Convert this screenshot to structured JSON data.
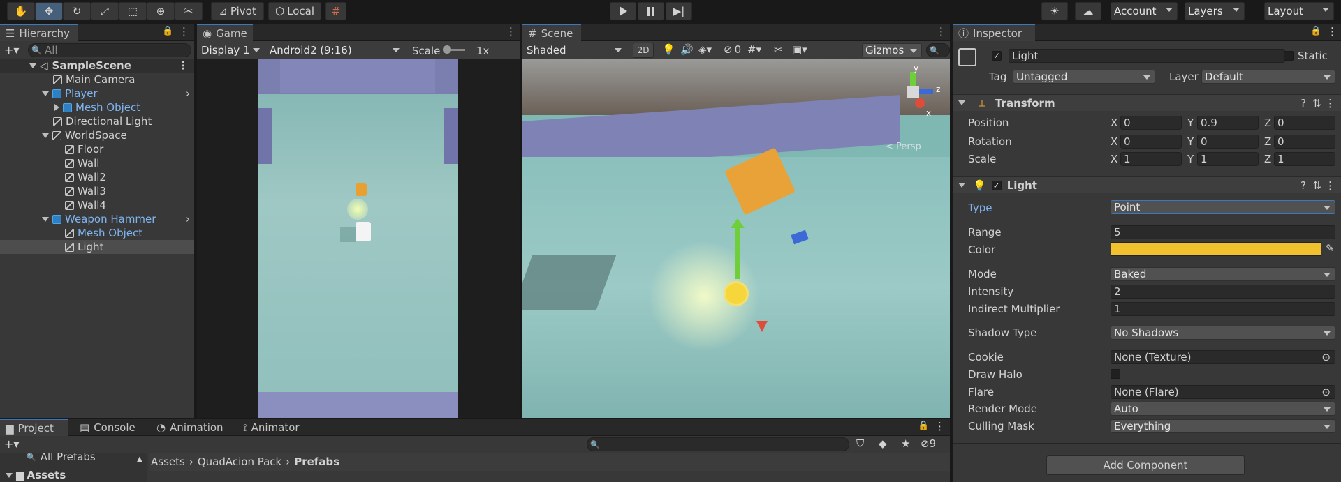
{
  "toolbar": {
    "pivot_label": "Pivot",
    "local_label": "Local",
    "account_label": "Account",
    "layers_label": "Layers",
    "layout_label": "Layout"
  },
  "hierarchy": {
    "tab_label": "Hierarchy",
    "search_placeholder": "All",
    "scene_name": "SampleScene",
    "items": [
      {
        "label": "Main Camera"
      },
      {
        "label": "Player"
      },
      {
        "label": "Mesh Object"
      },
      {
        "label": "Directional Light"
      },
      {
        "label": "WorldSpace"
      },
      {
        "label": "Floor"
      },
      {
        "label": "Wall"
      },
      {
        "label": "Wall2"
      },
      {
        "label": "Wall3"
      },
      {
        "label": "Wall4"
      },
      {
        "label": "Weapon Hammer"
      },
      {
        "label": "Mesh Object"
      },
      {
        "label": "Light"
      }
    ]
  },
  "game": {
    "tab_label": "Game",
    "display": "Display 1",
    "aspect": "Android2 (9:16)",
    "scale_label": "Scale",
    "scale_value": "1x"
  },
  "scene": {
    "tab_label": "Scene",
    "shading": "Shaded",
    "mode_2d": "2D",
    "hidden_count": "0",
    "gizmos_label": "Gizmos",
    "persp_label": "< Persp",
    "axis_x": "x",
    "axis_y": "y",
    "axis_z": "z"
  },
  "inspector": {
    "tab_label": "Inspector",
    "object_name": "Light",
    "static_label": "Static",
    "tag_label": "Tag",
    "tag_value": "Untagged",
    "layer_label": "Layer",
    "layer_value": "Default",
    "transform": {
      "title": "Transform",
      "position_label": "Position",
      "rotation_label": "Rotation",
      "scale_label": "Scale",
      "position": {
        "x": "0",
        "y": "0.9",
        "z": "0"
      },
      "rotation": {
        "x": "0",
        "y": "0",
        "z": "0"
      },
      "scale": {
        "x": "1",
        "y": "1",
        "z": "1"
      },
      "x": "X",
      "y": "Y",
      "z": "Z"
    },
    "light": {
      "title": "Light",
      "type_label": "Type",
      "type_value": "Point",
      "range_label": "Range",
      "range_value": "5",
      "color_label": "Color",
      "color_value": "#f2c12e",
      "mode_label": "Mode",
      "mode_value": "Baked",
      "intensity_label": "Intensity",
      "intensity_value": "2",
      "indirect_label": "Indirect Multiplier",
      "indirect_value": "1",
      "shadow_label": "Shadow Type",
      "shadow_value": "No Shadows",
      "cookie_label": "Cookie",
      "cookie_value": "None (Texture)",
      "halo_label": "Draw Halo",
      "flare_label": "Flare",
      "flare_value": "None (Flare)",
      "render_label": "Render Mode",
      "render_value": "Auto",
      "culling_label": "Culling Mask",
      "culling_value": "Everything"
    },
    "add_component": "Add Component"
  },
  "project": {
    "tabs": [
      "Project",
      "Console",
      "Animation",
      "Animator"
    ],
    "hidden_count": "9",
    "all_prefabs": "All Prefabs",
    "assets_root": "Assets",
    "breadcrumb": [
      "Assets",
      "QuadAcion Pack",
      "Prefabs"
    ]
  }
}
